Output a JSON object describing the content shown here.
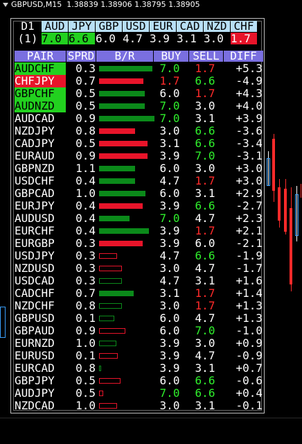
{
  "window": {
    "title": "GBPUSD,M15",
    "ohlc": "1.38839 1.38906 1.38795 1.38905"
  },
  "strength": {
    "timeframe": "D1",
    "rank_label": "(1)",
    "currencies": [
      {
        "name": "AUD",
        "value": "7.0",
        "bg": "#22d11f",
        "fg": "#000"
      },
      {
        "name": "JPY",
        "value": "6.6",
        "bg": "#22d11f",
        "fg": "#000"
      },
      {
        "name": "GBP",
        "value": "6.0",
        "bg": "#000",
        "fg": "#fff"
      },
      {
        "name": "USD",
        "value": "4.7",
        "bg": "#000",
        "fg": "#fff"
      },
      {
        "name": "EUR",
        "value": "3.9",
        "bg": "#000",
        "fg": "#fff"
      },
      {
        "name": "CAD",
        "value": "3.1",
        "bg": "#000",
        "fg": "#fff"
      },
      {
        "name": "NZD",
        "value": "3.0",
        "bg": "#000",
        "fg": "#fff"
      },
      {
        "name": "CHF",
        "value": "1.7",
        "bg": "#e8142a",
        "fg": "#fff"
      }
    ]
  },
  "table": {
    "headers": {
      "pair": "PAIR",
      "sprd": "SPRD",
      "br": "B/R",
      "buy": "BUY",
      "sell": "SELL",
      "diff": "DIFF"
    },
    "rows": [
      {
        "pair": "AUDCHF",
        "hl": "g",
        "sprd": "0.3",
        "bar": {
          "dir": "pos",
          "level": 0.96,
          "type": "solid"
        },
        "buy": "7.0",
        "buyc": "g",
        "sell": "1.7",
        "sellc": "r",
        "diff": "+5.3"
      },
      {
        "pair": "CHFJPY",
        "hl": "r",
        "sprd": "0.7",
        "bar": {
          "dir": "neg",
          "level": 0.8,
          "type": "solid"
        },
        "buy": "1.7",
        "buyc": "r",
        "sell": "6.6",
        "sellc": "g",
        "diff": "-4.9"
      },
      {
        "pair": "GBPCHF",
        "hl": "g",
        "sprd": "0.5",
        "bar": {
          "dir": "pos",
          "level": 0.82,
          "type": "solid"
        },
        "buy": "6.0",
        "buyc": "w",
        "sell": "1.7",
        "sellc": "r",
        "diff": "+4.3"
      },
      {
        "pair": "AUDNZD",
        "hl": "g",
        "sprd": "0.5",
        "bar": {
          "dir": "pos",
          "level": 0.82,
          "type": "solid"
        },
        "buy": "7.0",
        "buyc": "g",
        "sell": "3.0",
        "sellc": "w",
        "diff": "+4.0"
      },
      {
        "pair": "AUDCAD",
        "hl": "",
        "sprd": "0.9",
        "bar": {
          "dir": "pos",
          "level": 1.0,
          "type": "solid"
        },
        "buy": "7.0",
        "buyc": "g",
        "sell": "3.1",
        "sellc": "w",
        "diff": "+3.9"
      },
      {
        "pair": "NZDJPY",
        "hl": "",
        "sprd": "0.8",
        "bar": {
          "dir": "neg",
          "level": 0.65,
          "type": "solid"
        },
        "buy": "3.0",
        "buyc": "w",
        "sell": "6.6",
        "sellc": "g",
        "diff": "-3.6"
      },
      {
        "pair": "CADJPY",
        "hl": "",
        "sprd": "0.5",
        "bar": {
          "dir": "neg",
          "level": 0.87,
          "type": "solid"
        },
        "buy": "3.1",
        "buyc": "w",
        "sell": "6.6",
        "sellc": "g",
        "diff": "-3.4"
      },
      {
        "pair": "EURAUD",
        "hl": "",
        "sprd": "0.9",
        "bar": {
          "dir": "neg",
          "level": 0.87,
          "type": "solid"
        },
        "buy": "3.9",
        "buyc": "w",
        "sell": "7.0",
        "sellc": "g",
        "diff": "-3.1"
      },
      {
        "pair": "GBPNZD",
        "hl": "",
        "sprd": "1.1",
        "bar": {
          "dir": "pos",
          "level": 0.65,
          "type": "solid"
        },
        "buy": "6.0",
        "buyc": "w",
        "sell": "3.0",
        "sellc": "w",
        "diff": "+3.0"
      },
      {
        "pair": "USDCHF",
        "hl": "",
        "sprd": "0.4",
        "bar": {
          "dir": "pos",
          "level": 0.65,
          "type": "solid"
        },
        "buy": "4.7",
        "buyc": "w",
        "sell": "1.7",
        "sellc": "r",
        "diff": "+3.0"
      },
      {
        "pair": "GBPCAD",
        "hl": "",
        "sprd": "1.0",
        "bar": {
          "dir": "pos",
          "level": 0.84,
          "type": "solid"
        },
        "buy": "6.0",
        "buyc": "w",
        "sell": "3.1",
        "sellc": "w",
        "diff": "+2.9"
      },
      {
        "pair": "EURJPY",
        "hl": "",
        "sprd": "0.4",
        "bar": {
          "dir": "neg",
          "level": 0.79,
          "type": "solid"
        },
        "buy": "3.9",
        "buyc": "w",
        "sell": "6.6",
        "sellc": "g",
        "diff": "-2.7"
      },
      {
        "pair": "AUDUSD",
        "hl": "",
        "sprd": "0.4",
        "bar": {
          "dir": "pos",
          "level": 0.55,
          "type": "solid"
        },
        "buy": "7.0",
        "buyc": "g",
        "sell": "4.7",
        "sellc": "w",
        "diff": "+2.3"
      },
      {
        "pair": "EURCHF",
        "hl": "",
        "sprd": "0.4",
        "bar": {
          "dir": "pos",
          "level": 0.9,
          "type": "solid"
        },
        "buy": "3.9",
        "buyc": "w",
        "sell": "1.7",
        "sellc": "r",
        "diff": "+2.1"
      },
      {
        "pair": "EURGBP",
        "hl": "",
        "sprd": "0.3",
        "bar": {
          "dir": "neg",
          "level": 0.79,
          "type": "solid"
        },
        "buy": "3.9",
        "buyc": "w",
        "sell": "6.0",
        "sellc": "w",
        "diff": "-2.1"
      },
      {
        "pair": "USDJPY",
        "hl": "",
        "sprd": "0.3",
        "bar": {
          "dir": "neg",
          "level": 0.32,
          "type": "outline"
        },
        "buy": "4.7",
        "buyc": "w",
        "sell": "6.6",
        "sellc": "g",
        "diff": "-1.9"
      },
      {
        "pair": "NZDUSD",
        "hl": "",
        "sprd": "0.3",
        "bar": {
          "dir": "neg",
          "level": 0.41,
          "type": "outline"
        },
        "buy": "3.0",
        "buyc": "w",
        "sell": "4.7",
        "sellc": "w",
        "diff": "-1.7"
      },
      {
        "pair": "USDCAD",
        "hl": "",
        "sprd": "0.3",
        "bar": {
          "dir": "pos",
          "level": 0.41,
          "type": "outline"
        },
        "buy": "4.7",
        "buyc": "w",
        "sell": "3.1",
        "sellc": "w",
        "diff": "+1.6"
      },
      {
        "pair": "CADCHF",
        "hl": "",
        "sprd": "0.7",
        "bar": {
          "dir": "pos",
          "level": 0.62,
          "type": "solid"
        },
        "buy": "3.1",
        "buyc": "w",
        "sell": "1.7",
        "sellc": "r",
        "diff": "+1.4"
      },
      {
        "pair": "NZDCHF",
        "hl": "",
        "sprd": "0.8",
        "bar": {
          "dir": "pos",
          "level": 0.41,
          "type": "outline"
        },
        "buy": "3.0",
        "buyc": "w",
        "sell": "1.7",
        "sellc": "r",
        "diff": "+1.3"
      },
      {
        "pair": "GBPUSD",
        "hl": "",
        "sprd": "0.1",
        "bar": {
          "dir": "pos",
          "level": 0.27,
          "type": "outline"
        },
        "buy": "6.0",
        "buyc": "w",
        "sell": "4.7",
        "sellc": "w",
        "diff": "+1.3"
      },
      {
        "pair": "GBPAUD",
        "hl": "",
        "sprd": "0.9",
        "bar": {
          "dir": "neg",
          "level": 0.48,
          "type": "outline"
        },
        "buy": "6.0",
        "buyc": "w",
        "sell": "7.0",
        "sellc": "g",
        "diff": "-1.0"
      },
      {
        "pair": "EURNZD",
        "hl": "",
        "sprd": "1.0",
        "bar": {
          "dir": "pos",
          "level": 0.31,
          "type": "outline"
        },
        "buy": "3.9",
        "buyc": "w",
        "sell": "3.0",
        "sellc": "w",
        "diff": "+0.9"
      },
      {
        "pair": "EURUSD",
        "hl": "",
        "sprd": "0.1",
        "bar": {
          "dir": "neg",
          "level": 0.34,
          "type": "outline"
        },
        "buy": "3.9",
        "buyc": "w",
        "sell": "4.7",
        "sellc": "w",
        "diff": "-0.9"
      },
      {
        "pair": "EURCAD",
        "hl": "",
        "sprd": "0.8",
        "bar": {
          "dir": "pos",
          "level": 0.04,
          "type": "outline"
        },
        "buy": "3.9",
        "buyc": "w",
        "sell": "3.1",
        "sellc": "w",
        "diff": "+0.7"
      },
      {
        "pair": "GBPJPY",
        "hl": "",
        "sprd": "0.5",
        "bar": {
          "dir": "neg",
          "level": 0.39,
          "type": "outline"
        },
        "buy": "6.0",
        "buyc": "w",
        "sell": "6.6",
        "sellc": "g",
        "diff": "-0.6"
      },
      {
        "pair": "AUDJPY",
        "hl": "",
        "sprd": "0.5",
        "bar": {
          "dir": "neg",
          "level": 0.08,
          "type": "outline"
        },
        "buy": "7.0",
        "buyc": "g",
        "sell": "6.6",
        "sellc": "g",
        "diff": "+0.4"
      },
      {
        "pair": "NZDCAD",
        "hl": "",
        "sprd": "1.0",
        "bar": {
          "dir": "neg",
          "level": 0.33,
          "type": "outline"
        },
        "buy": "3.0",
        "buyc": "w",
        "sell": "3.1",
        "sellc": "w",
        "diff": "-0.1"
      }
    ]
  },
  "colors": {
    "pos": "#0b8a1a",
    "neg": "#e8142a",
    "hl_green": "#22d11f",
    "hl_red": "#e8142a",
    "header_bg": "#7a6fe0",
    "cur_bg": "#b8dff5",
    "up_text": "#2ff02c",
    "down_text": "#ff2a2a"
  }
}
